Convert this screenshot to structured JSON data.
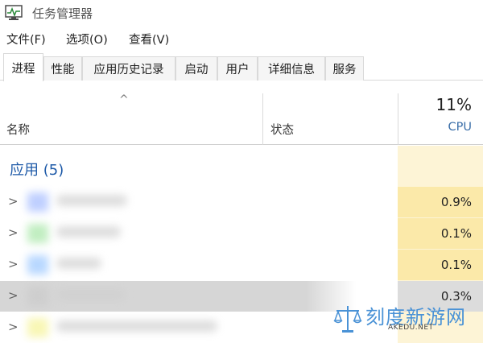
{
  "window": {
    "title": "任务管理器",
    "icon": "task-manager-icon"
  },
  "menu": [
    {
      "label": "文件(F)"
    },
    {
      "label": "选项(O)"
    },
    {
      "label": "查看(V)"
    }
  ],
  "tabs": [
    {
      "label": "进程",
      "active": true
    },
    {
      "label": "性能"
    },
    {
      "label": "应用历史记录"
    },
    {
      "label": "启动"
    },
    {
      "label": "用户"
    },
    {
      "label": "详细信息"
    },
    {
      "label": "服务"
    }
  ],
  "header": {
    "sort_arrow": "^",
    "name": "名称",
    "status": "状态",
    "cpu_total": "11%",
    "cpu_label": "CPU"
  },
  "group": {
    "title": "应用 (5)"
  },
  "rows": [
    {
      "cpu": "0.9%",
      "icon_color": "#8aa8ff",
      "name_width": 88
    },
    {
      "cpu": "0.1%",
      "icon_color": "#8fe08f",
      "name_width": 80
    },
    {
      "cpu": "0.1%",
      "icon_color": "#7fb8ff",
      "name_width": 56
    },
    {
      "cpu": "0.3%",
      "icon_color": "#c8c8c8",
      "name_width": 86,
      "selected": true
    },
    {
      "cpu": "",
      "icon_color": "#f3f07a",
      "name_width": 200
    }
  ],
  "colors": {
    "cpu_light": "#fdf4d6",
    "cpu_medium": "#fbe9a9",
    "accent": "#1e5aa8",
    "selected_row": "#d6d6d6"
  },
  "watermark": {
    "text": "刻度新游网",
    "sub": "AKEDU.NET",
    "icon": "scale-icon"
  }
}
